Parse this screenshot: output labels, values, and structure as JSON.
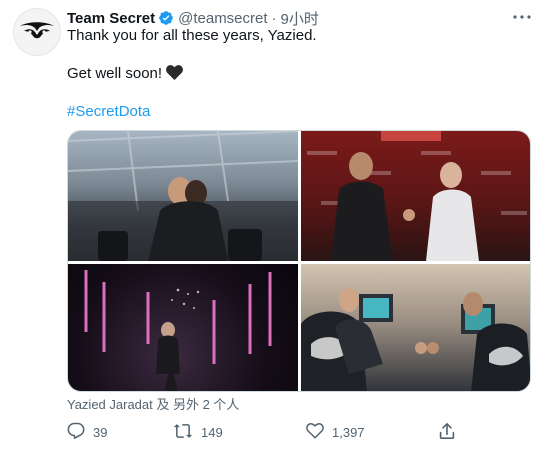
{
  "tweet": {
    "author_name": "Team Secret",
    "author_handle": "@teamsecret",
    "time_separator": "·",
    "timestamp": "9小时",
    "lines": [
      "Thank you for all these years, Yazied.",
      "Get well soon!",
      "#SecretDota"
    ],
    "tagged_people": "Yazied Jaradat 及 另外 2 个人",
    "stats": {
      "replies": "39",
      "retweets": "149",
      "likes": "1,397"
    }
  },
  "icons": {
    "avatar": "team-secret-logo",
    "verified": "verified-badge-icon",
    "more": "more-options-icon",
    "heart": "black-heart-emoji",
    "reply": "reply-icon",
    "retweet": "retweet-icon",
    "like": "like-icon",
    "share": "share-icon"
  },
  "colors": {
    "link": "#1d9bf0",
    "verified": "#1d9bf0",
    "muted": "#536471",
    "text": "#0f1419"
  }
}
